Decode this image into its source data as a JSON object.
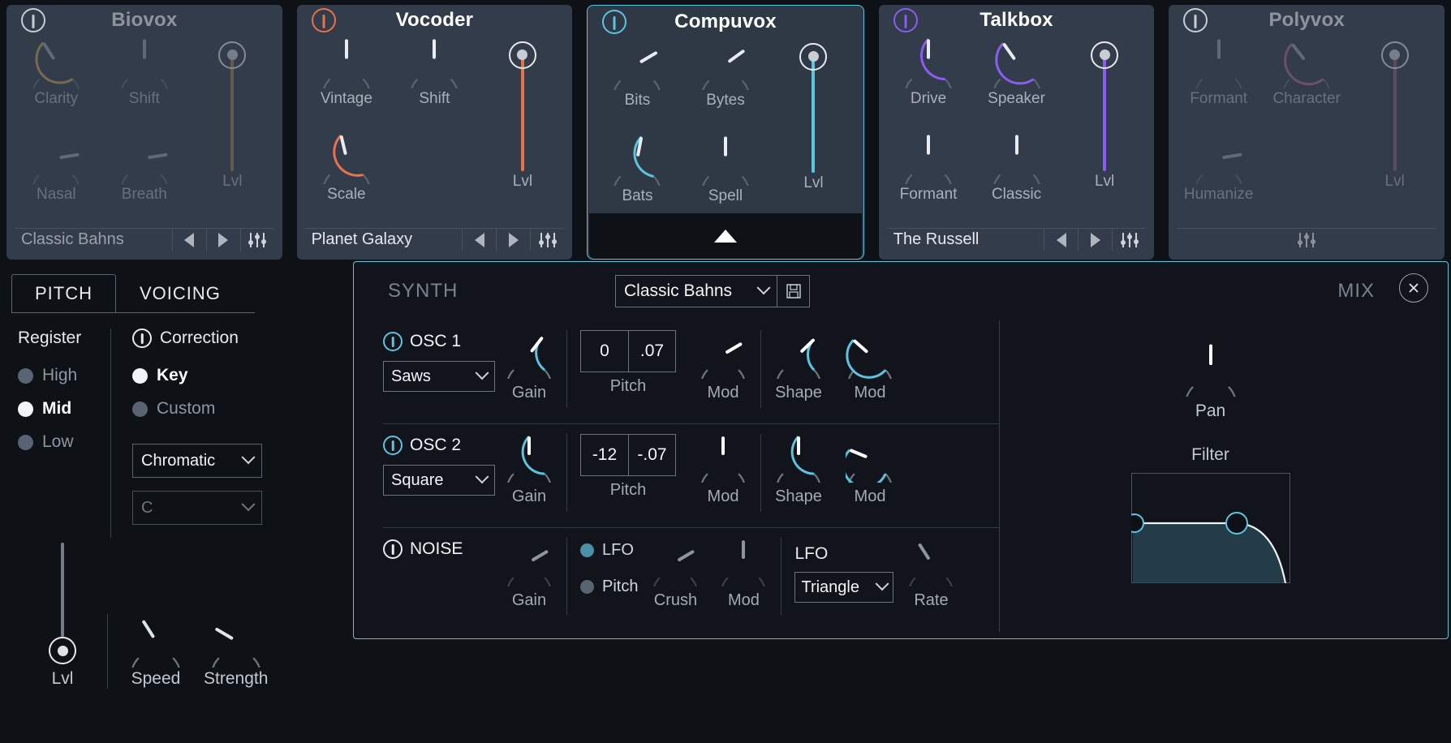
{
  "modules": [
    {
      "name": "Biovox",
      "power_color": "#c8ccd3",
      "enabled": false,
      "selected": false,
      "accent": "#c9a15a",
      "knobs": [
        {
          "label": "Clarity",
          "value": 0.62,
          "arc": true
        },
        {
          "label": "Shift",
          "value": 0.5,
          "arc": false
        },
        {
          "label": "Nasal",
          "value": 0.2,
          "arc": false
        },
        {
          "label": "Breath",
          "value": 0.2,
          "arc": false
        }
      ],
      "fader": {
        "label": "Lvl",
        "value": 0.8
      },
      "preset": "Classic Bahns",
      "has_preset_bar": true
    },
    {
      "name": "Vocoder",
      "power_color": "#e8724a",
      "enabled": true,
      "selected": false,
      "accent": "#e8724a",
      "knobs": [
        {
          "label": "Vintage",
          "value": 0.5,
          "arc": false
        },
        {
          "label": "Shift",
          "value": 0.5,
          "arc": false
        },
        {
          "label": "Scale",
          "value": 0.55,
          "arc": true
        },
        {
          "label": "",
          "value": 0,
          "arc": false
        }
      ],
      "fader": {
        "label": "Lvl",
        "value": 0.8
      },
      "preset": "Planet Galaxy",
      "has_preset_bar": true
    },
    {
      "name": "Compuvox",
      "power_color": "#5cc4e0",
      "enabled": true,
      "selected": true,
      "accent": "#5cc4e0",
      "knobs": [
        {
          "label": "Bits",
          "value": 0.28,
          "arc": false
        },
        {
          "label": "Bytes",
          "value": 0.3,
          "arc": false
        },
        {
          "label": "Bats",
          "value": 0.46,
          "arc": true
        },
        {
          "label": "Spell",
          "value": 0.5,
          "arc": false
        }
      ],
      "fader": {
        "label": "Lvl",
        "value": 0.8
      },
      "preset": "",
      "has_preset_bar": false
    },
    {
      "name": "Talkbox",
      "power_color": "#8a5cf0",
      "enabled": true,
      "selected": false,
      "accent": "#8a5cf0",
      "knobs": [
        {
          "label": "Drive",
          "value": 0.5,
          "arc": true
        },
        {
          "label": "Speaker",
          "value": 0.63,
          "arc": true
        },
        {
          "label": "Formant",
          "value": 0.5,
          "arc": false
        },
        {
          "label": "Classic",
          "value": 0.5,
          "arc": false
        }
      ],
      "fader": {
        "label": "Lvl",
        "value": 0.8
      },
      "preset": "The Russell",
      "has_preset_bar": true
    },
    {
      "name": "Polyvox",
      "power_color": "#c8ccd3",
      "enabled": false,
      "selected": false,
      "accent": "#b06a9a",
      "knobs": [
        {
          "label": "Formant",
          "value": 0.5,
          "arc": false
        },
        {
          "label": "Character",
          "value": 0.64,
          "arc": true
        },
        {
          "label": "Humanize",
          "value": 0.2,
          "arc": false
        },
        {
          "label": "",
          "value": 0,
          "arc": false
        }
      ],
      "fader": {
        "label": "Lvl",
        "value": 0.8
      },
      "preset": "",
      "has_preset_bar": false
    }
  ],
  "left_panel": {
    "tabs": [
      {
        "label": "PITCH",
        "active": true
      },
      {
        "label": "VOICING",
        "active": false
      }
    ],
    "register": {
      "title": "Register",
      "options": [
        {
          "label": "High",
          "selected": false
        },
        {
          "label": "Mid",
          "selected": true
        },
        {
          "label": "Low",
          "selected": false
        }
      ]
    },
    "correction": {
      "title": "Correction",
      "options": [
        {
          "label": "Key",
          "selected": true
        },
        {
          "label": "Custom",
          "selected": false
        }
      ],
      "scale": "Chromatic",
      "root": "C"
    },
    "level": {
      "label": "Lvl",
      "value": 0.1
    },
    "knobs": [
      {
        "label": "Speed",
        "value": 0.62
      },
      {
        "label": "Strength",
        "value": 0.72
      }
    ]
  },
  "synth": {
    "section_title": "SYNTH",
    "mix_title": "MIX",
    "preset": "Classic Bahns",
    "save_icon": "save-icon",
    "close_icon": "close-icon",
    "rows": [
      {
        "name": "OSC 1",
        "wave": "Saws",
        "gain": {
          "label": "Gain",
          "value": 0.36
        },
        "pitch": {
          "label": "Pitch",
          "semitones": "0",
          "cents": ".07"
        },
        "pitch_mod": {
          "label": "Mod",
          "value": 0.28
        },
        "shape": {
          "label": "Shape",
          "value": 0.33
        },
        "shape_mod": {
          "label": "Mod",
          "value": 0.68
        }
      },
      {
        "name": "OSC 2",
        "wave": "Square",
        "gain": {
          "label": "Gain",
          "value": 0.5
        },
        "pitch": {
          "label": "Pitch",
          "semitones": "-12",
          "cents": "-.07"
        },
        "pitch_mod": {
          "label": "Mod",
          "value": 0.5
        },
        "shape": {
          "label": "Shape",
          "value": 0.5
        },
        "shape_mod": {
          "label": "Mod",
          "value": 0.75
        }
      }
    ],
    "noise": {
      "name": "NOISE",
      "gain": {
        "label": "Gain",
        "value": 0.28
      },
      "targets": [
        {
          "label": "LFO",
          "selected": true
        },
        {
          "label": "Pitch",
          "selected": false
        }
      ],
      "crush": {
        "label": "Crush",
        "value": 0.28
      },
      "crush_mod": {
        "label": "Mod",
        "value": 0.5
      }
    },
    "lfo": {
      "title": "LFO",
      "shape": "Triangle",
      "rate": {
        "label": "Rate",
        "value": 0.62
      }
    },
    "mix": {
      "pan": {
        "label": "Pan",
        "value": 0.5
      },
      "filter": {
        "label": "Filter",
        "lo_handle_x": 0.02,
        "hi_handle_x": 0.76
      }
    }
  }
}
